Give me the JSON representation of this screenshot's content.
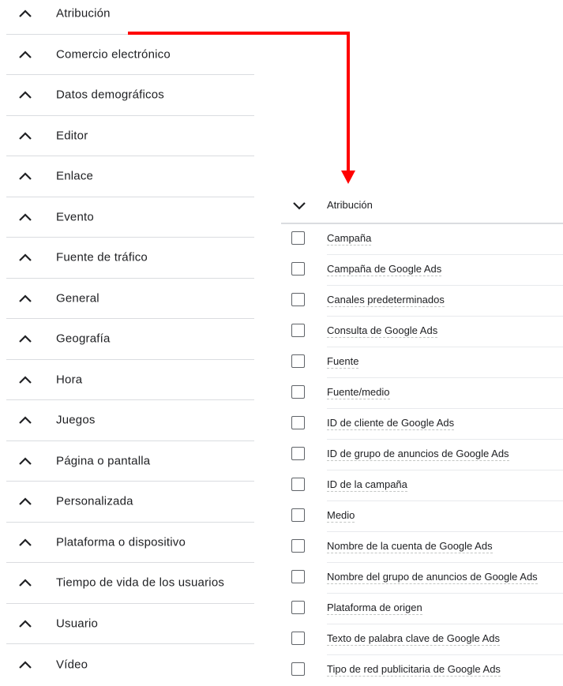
{
  "categories": [
    "Atribución",
    "Comercio electrónico",
    "Datos demográficos",
    "Editor",
    "Enlace",
    "Evento",
    "Fuente de tráfico",
    "General",
    "Geografía",
    "Hora",
    "Juegos",
    "Página o pantalla",
    "Personalizada",
    "Plataforma o dispositivo",
    "Tiempo de vida de los usuarios",
    "Usuario",
    "Vídeo"
  ],
  "expanded_section": {
    "title": "Atribución",
    "options": [
      "Campaña",
      "Campaña de Google Ads",
      "Canales predeterminados",
      "Consulta de Google Ads",
      "Fuente",
      "Fuente/medio",
      "ID de cliente de Google Ads",
      "ID de grupo de anuncios de Google Ads",
      "ID de la campaña",
      "Medio",
      "Nombre de la cuenta de Google Ads",
      "Nombre del grupo de anuncios de Google Ads",
      "Plataforma de origen",
      "Texto de palabra clave de Google Ads",
      "Tipo de red publicitaria de Google Ads"
    ]
  },
  "colors": {
    "arrow": "#ff0000",
    "divider": "#dadce0",
    "checkbox_border": "#5f6368"
  },
  "icons": {
    "collapsed": "chevron-up-icon",
    "expanded": "chevron-down-icon"
  }
}
